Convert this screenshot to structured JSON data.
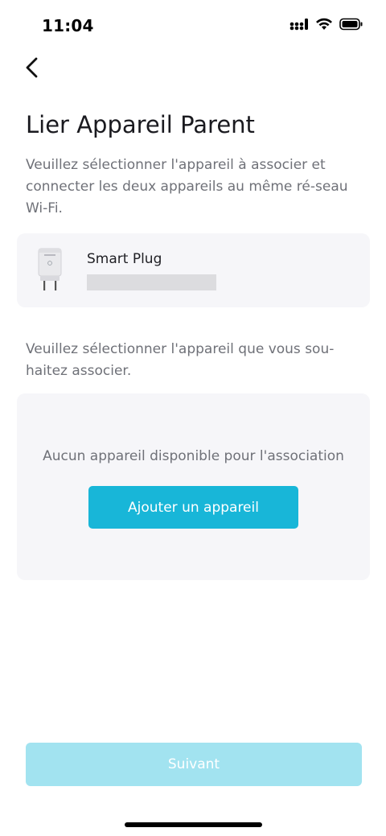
{
  "status_bar": {
    "time": "11:04",
    "icons": [
      "cellular-signal-icon",
      "wifi-icon",
      "battery-icon"
    ]
  },
  "nav": {
    "back_icon": "chevron-left-icon"
  },
  "page": {
    "title": "Lier Appareil Parent",
    "description": "Veuillez sélectionner l'appareil à associer et connecter les deux appareils au même ré-seau Wi-Fi."
  },
  "parent_device": {
    "name": "Smart Plug",
    "image_icon": "smart-plug-image"
  },
  "select_section": {
    "description": "Veuillez sélectionner l'appareil que vous sou-haitez associer."
  },
  "empty_list": {
    "message": "Aucun appareil disponible pour l'association",
    "add_button_label": "Ajouter un appareil"
  },
  "footer": {
    "next_label": "Suivant",
    "next_enabled": false
  },
  "colors": {
    "accent": "#18b6d8",
    "accent_disabled": "#a2e3f0",
    "card_background": "#f6f6f9",
    "secondary_text": "#6f7178"
  }
}
